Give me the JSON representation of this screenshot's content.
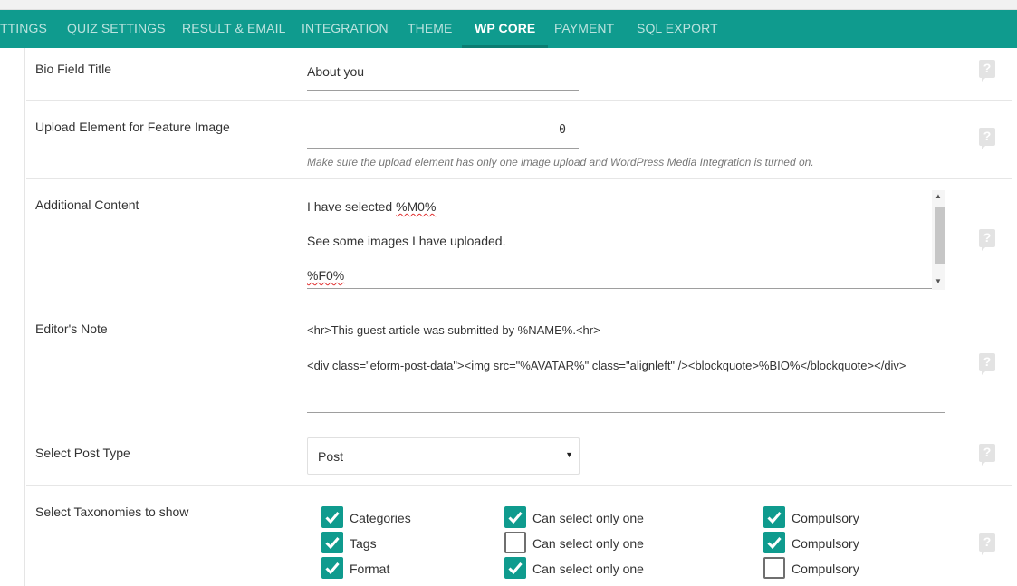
{
  "tabs": [
    {
      "label": "TTINGS"
    },
    {
      "label": "QUIZ SETTINGS"
    },
    {
      "label": "RESULT & EMAIL"
    },
    {
      "label": "INTEGRATION"
    },
    {
      "label": "THEME"
    },
    {
      "label": "WP CORE",
      "active": true
    },
    {
      "label": "PAYMENT"
    },
    {
      "label": "SQL EXPORT"
    }
  ],
  "help_icon": "?",
  "bio": {
    "label": "Bio Field Title",
    "value": "About you"
  },
  "upload": {
    "label": "Upload Element for Feature Image",
    "value": "0",
    "hint": "Make sure the upload element has only one image upload and WordPress Media Integration is turned on."
  },
  "additional": {
    "label": "Additional Content",
    "line1_prefix": "I have selected ",
    "line1_token": "%M0%",
    "line2": "See some images I have uploaded.",
    "line3_token": "%F0%"
  },
  "editor_note": {
    "label": "Editor's Note",
    "line1": "<hr>This guest article was submitted by %NAME%.<hr>",
    "line2": "<div class=\"eform-post-data\"><img src=\"%AVATAR%\" class=\"alignleft\" /><blockquote>%BIO%</blockquote></div>"
  },
  "post_type": {
    "label": "Select Post Type",
    "selected": "Post"
  },
  "taxonomies": {
    "label": "Select Taxonomies to show",
    "rows": [
      {
        "name": "Categories",
        "name_checked": true,
        "single_label": "Can select only one",
        "single_checked": true,
        "comp_label": "Compulsory",
        "comp_checked": true
      },
      {
        "name": "Tags",
        "name_checked": true,
        "single_label": "Can select only one",
        "single_checked": false,
        "comp_label": "Compulsory",
        "comp_checked": true
      },
      {
        "name": "Format",
        "name_checked": true,
        "single_label": "Can select only one",
        "single_checked": true,
        "comp_label": "Compulsory",
        "comp_checked": false
      }
    ]
  },
  "colors": {
    "accent": "#0f9b8e",
    "tab_underline": "#0b7d72",
    "help": "#e3e3e3"
  }
}
